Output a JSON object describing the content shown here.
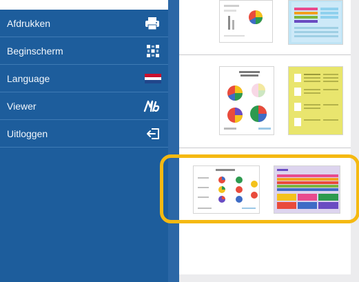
{
  "menu": {
    "items": [
      {
        "label": "Afdrukken",
        "icon": "printer-icon"
      },
      {
        "label": "Beginscherm",
        "icon": "grid-icon"
      },
      {
        "label": "Language",
        "icon": "dutch-flag-icon"
      },
      {
        "label": "Viewer",
        "icon": "viewer-logo-icon"
      },
      {
        "label": "Uitloggen",
        "icon": "logout-icon"
      }
    ]
  },
  "colors": {
    "sidebar": "#1d5d9c",
    "highlight": "#f5b911",
    "flag_red": "#c8102e",
    "flag_blue": "#21468b"
  }
}
